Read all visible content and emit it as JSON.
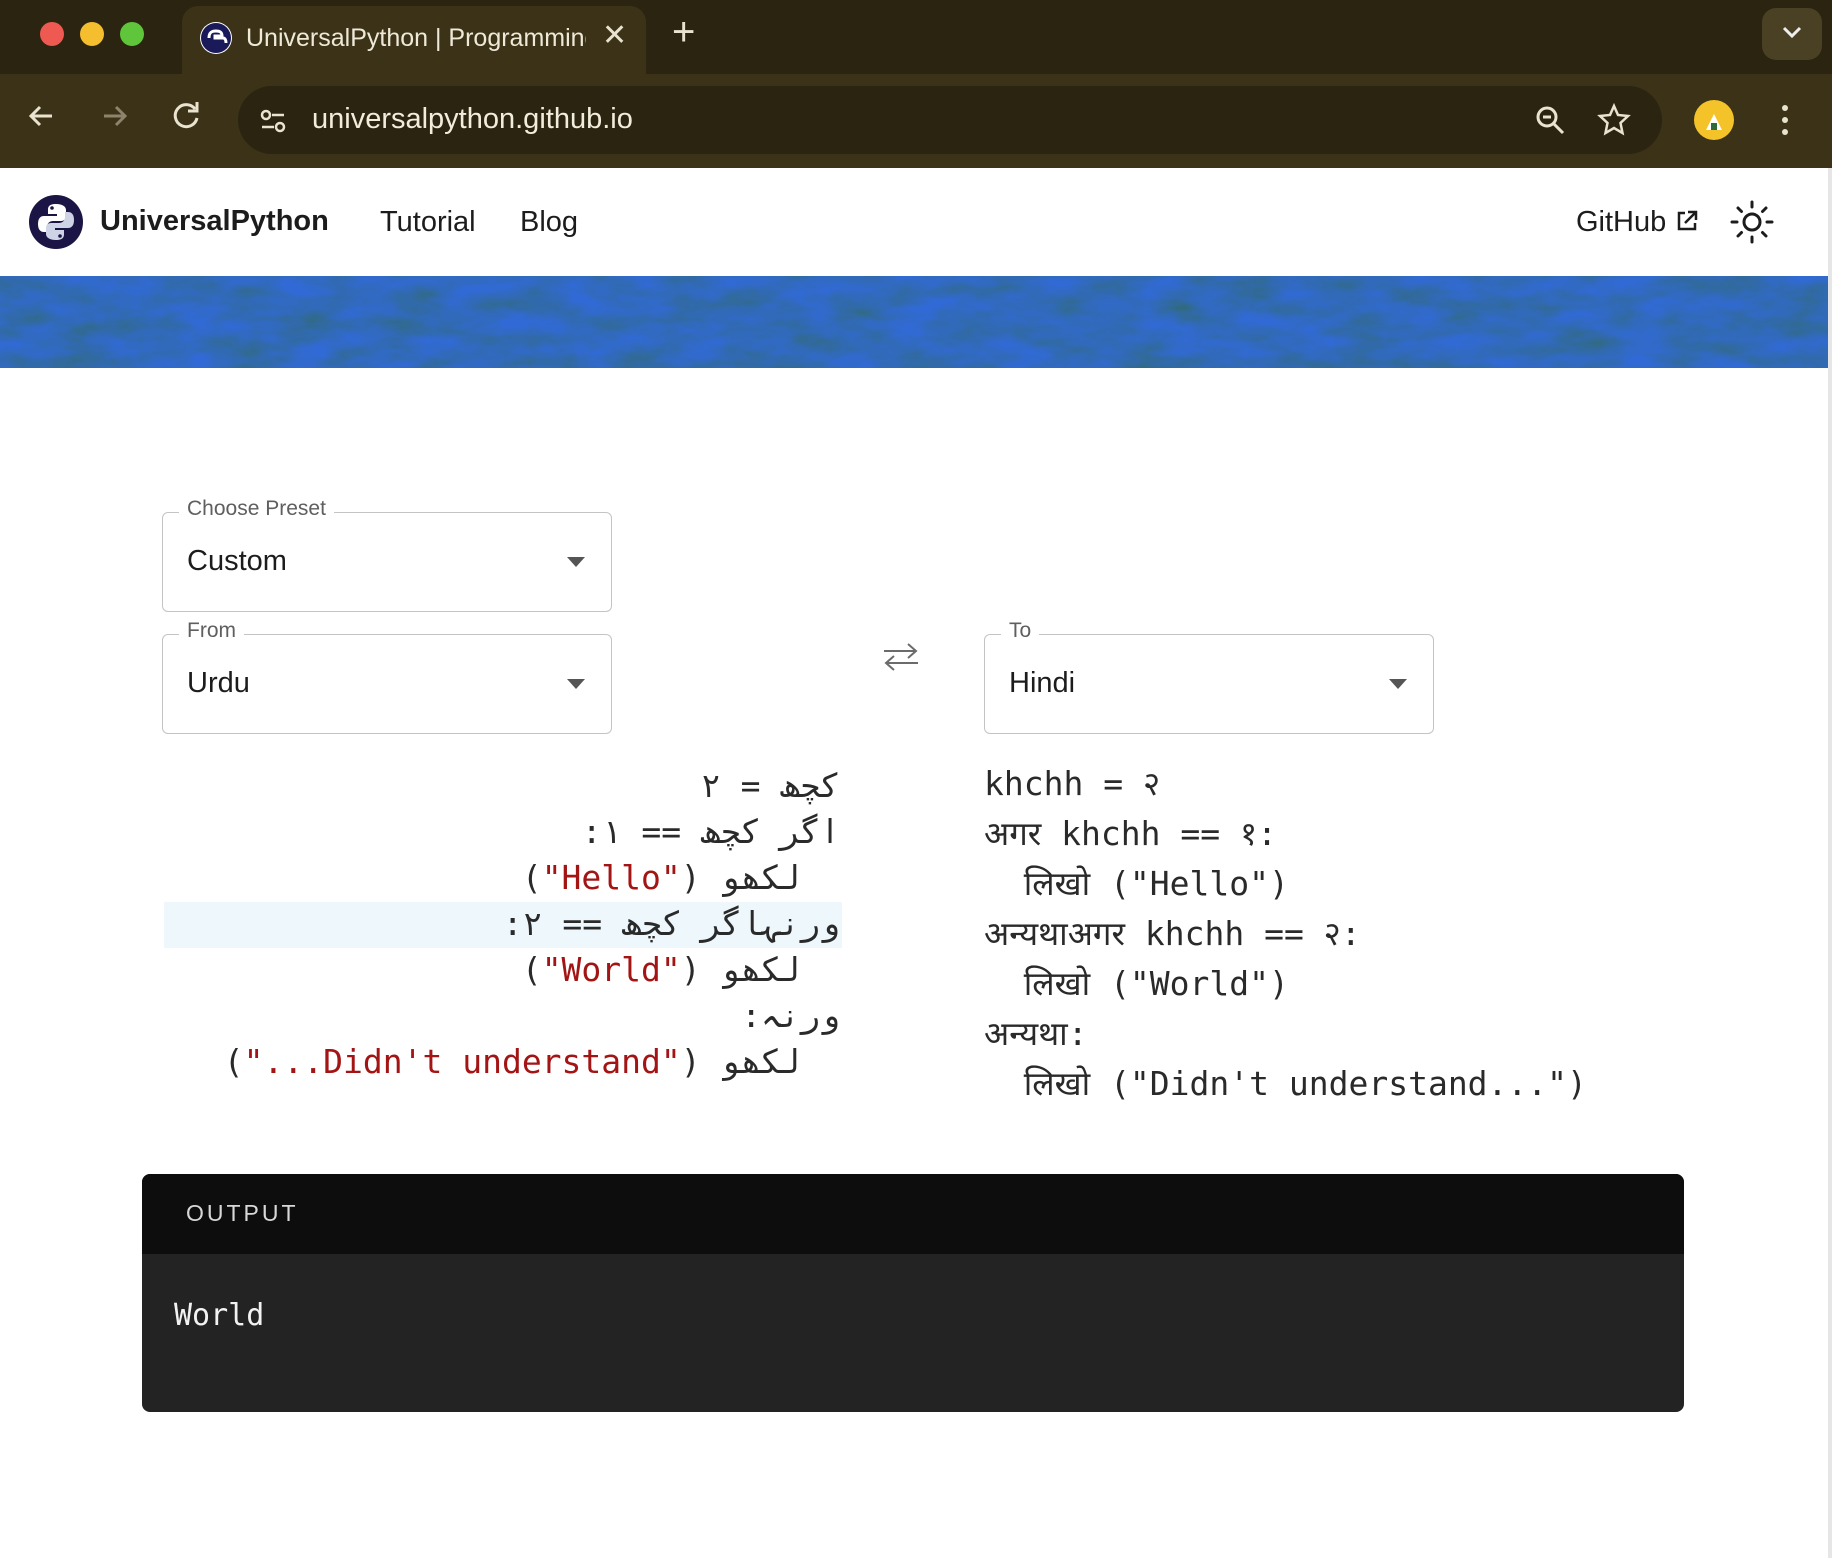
{
  "browser": {
    "tab_title": "UniversalPython | Programming",
    "url": "universalpython.github.io",
    "icons": [
      "back-arrow-icon",
      "forward-arrow-icon",
      "reload-icon",
      "site-settings-icon",
      "zoom-icon",
      "bookmark-star-icon",
      "profile-icon",
      "more-vert-icon",
      "tab-search-icon",
      "new-tab-icon",
      "close-icon"
    ]
  },
  "header": {
    "brand": "UniversalPython",
    "nav": [
      "Tutorial",
      "Blog"
    ],
    "github": "GitHub",
    "icons": [
      "python-logo-icon",
      "external-link-icon",
      "sun-icon"
    ]
  },
  "controls": {
    "preset": {
      "label": "Choose Preset",
      "value": "Custom"
    },
    "from": {
      "label": "From",
      "value": "Urdu"
    },
    "to": {
      "label": "To",
      "value": "Hindi"
    },
    "swap_icon": "swap-arrows-icon"
  },
  "source_code": [
    "کچھ = ۲",
    "اگر کچھ == ۱:",
    "    لکھو (\"Hello\")",
    "ورنہاگر کچھ == ۲:",
    "    لکھو (\"World\")",
    "ورنہ:",
    "    لکھو (\"Didn't understand...\")"
  ],
  "source_parts": {
    "l0": "کچھ = ۲",
    "l1": "اگر کچھ == ۱:",
    "l2_kw": "لکھو",
    "l2_str": "\"Hello\"",
    "l3": "ورنہاگر کچھ == ۲:",
    "l4_kw": "لکھو",
    "l4_str": "\"World\"",
    "l5": "ورنہ:",
    "l6_kw": "لکھو",
    "l6_str": "\"...Didn't understand\""
  },
  "target_code": [
    "khchh = २",
    "अगर khchh == १:",
    "  लिखो (\"Hello\")",
    "अन्यथाअगर khchh == २:",
    "  लिखो (\"World\")",
    "अन्यथा:",
    "  लिखो (\"Didn't understand...\")"
  ],
  "colors": {
    "string": "#a31515",
    "highlight": "#eef7fb",
    "chrome": "#3b3217",
    "output_header": "#0d0d0d",
    "output_body": "#232323"
  },
  "output": {
    "title": "OUTPUT",
    "text": "World"
  }
}
